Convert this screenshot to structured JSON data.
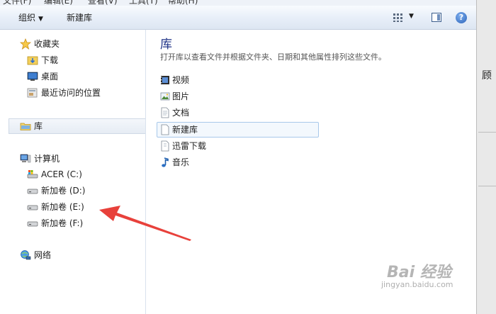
{
  "menubar": {
    "items": [
      "文件(F)",
      "编辑(E)",
      "查看(V)",
      "工具(T)",
      "帮助(H)"
    ]
  },
  "toolbar": {
    "organize_label": "组织",
    "new_library_label": "新建库",
    "help_label": "?"
  },
  "nav": {
    "favorites_label": "收藏夹",
    "favorites": [
      "下载",
      "桌面",
      "最近访问的位置"
    ],
    "libraries_label": "库",
    "computer_label": "计算机",
    "drives": [
      "ACER (C:)",
      "新加卷 (D:)",
      "新加卷 (E:)",
      "新加卷 (F:)"
    ],
    "network_label": "网络"
  },
  "content": {
    "title": "库",
    "description": "打开库以查看文件并根据文件夹、日期和其他属性排列这些文件。",
    "libraries": [
      "视频",
      "图片",
      "文档",
      "新建库",
      "迅雷下载",
      "音乐"
    ],
    "selected": "新建库"
  },
  "edge": {
    "text": "顾"
  },
  "watermark": {
    "brand": "Bai 经验",
    "url": "jingyan.baidu.com"
  },
  "colors": {
    "annotation_arrow": "#e8413b",
    "title": "#1e3287",
    "selection": "#a8c8ea"
  }
}
